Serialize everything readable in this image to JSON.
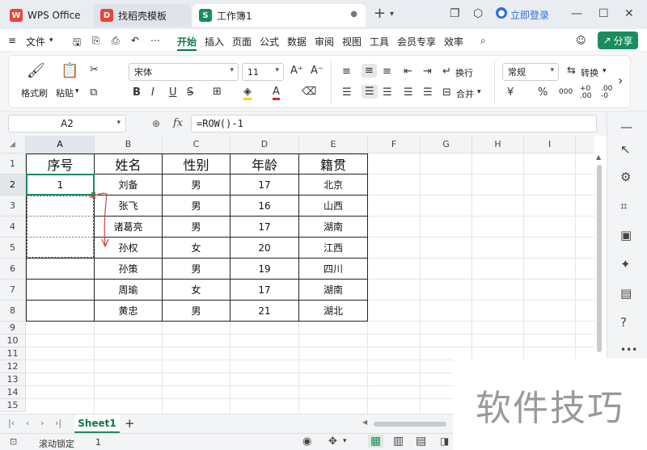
{
  "titlebar": {
    "tabs": [
      {
        "label": "WPS Office"
      },
      {
        "label": "找稻壳模板"
      },
      {
        "label": "工作簿1"
      }
    ],
    "login_label": "立即登录"
  },
  "menu": {
    "file": "文件",
    "items": [
      "开始",
      "插入",
      "页面",
      "公式",
      "数据",
      "审阅",
      "视图",
      "工具",
      "会员专享",
      "效率"
    ],
    "share": "分享"
  },
  "ribbon": {
    "format_painter": "格式刷",
    "paste": "粘贴",
    "font_name": "宋体",
    "font_size": "11",
    "wrap": "换行",
    "merge": "合并",
    "number_format": "常规",
    "convert": "转换",
    "bold": "B",
    "italic": "I",
    "underline": "U",
    "currency": "¥",
    "percent": "%",
    "thousands": "000"
  },
  "formula_bar": {
    "cell_ref": "A2",
    "fx": "fx",
    "formula": "=ROW()-1"
  },
  "sheet": {
    "columns": [
      "A",
      "B",
      "C",
      "D",
      "E",
      "F",
      "G",
      "H",
      "I"
    ],
    "rows": [
      "1",
      "2",
      "3",
      "4",
      "5",
      "6",
      "7",
      "8",
      "9",
      "10",
      "11",
      "12",
      "13",
      "14",
      "15"
    ],
    "headers": [
      "序号",
      "姓名",
      "性别",
      "年龄",
      "籍贯"
    ],
    "data": [
      [
        "1",
        "刘备",
        "男",
        "17",
        "北京"
      ],
      [
        "",
        "张飞",
        "男",
        "16",
        "山西"
      ],
      [
        "",
        "诸葛亮",
        "男",
        "17",
        "湖南"
      ],
      [
        "",
        "孙权",
        "女",
        "20",
        "江西"
      ],
      [
        "",
        "孙策",
        "男",
        "19",
        "四川"
      ],
      [
        "",
        "周瑜",
        "女",
        "17",
        "湖南"
      ],
      [
        "",
        "黄忠",
        "男",
        "21",
        "湖北"
      ]
    ]
  },
  "sheet_tabs": {
    "active": "Sheet1",
    "add": "+"
  },
  "status": {
    "scroll_lock": "滚动锁定",
    "value": "1"
  },
  "watermark": "软件技巧",
  "colors": {
    "accent": "#1a8d5f",
    "active_menu": "#0a7a48",
    "arrow": "#d0453a"
  }
}
